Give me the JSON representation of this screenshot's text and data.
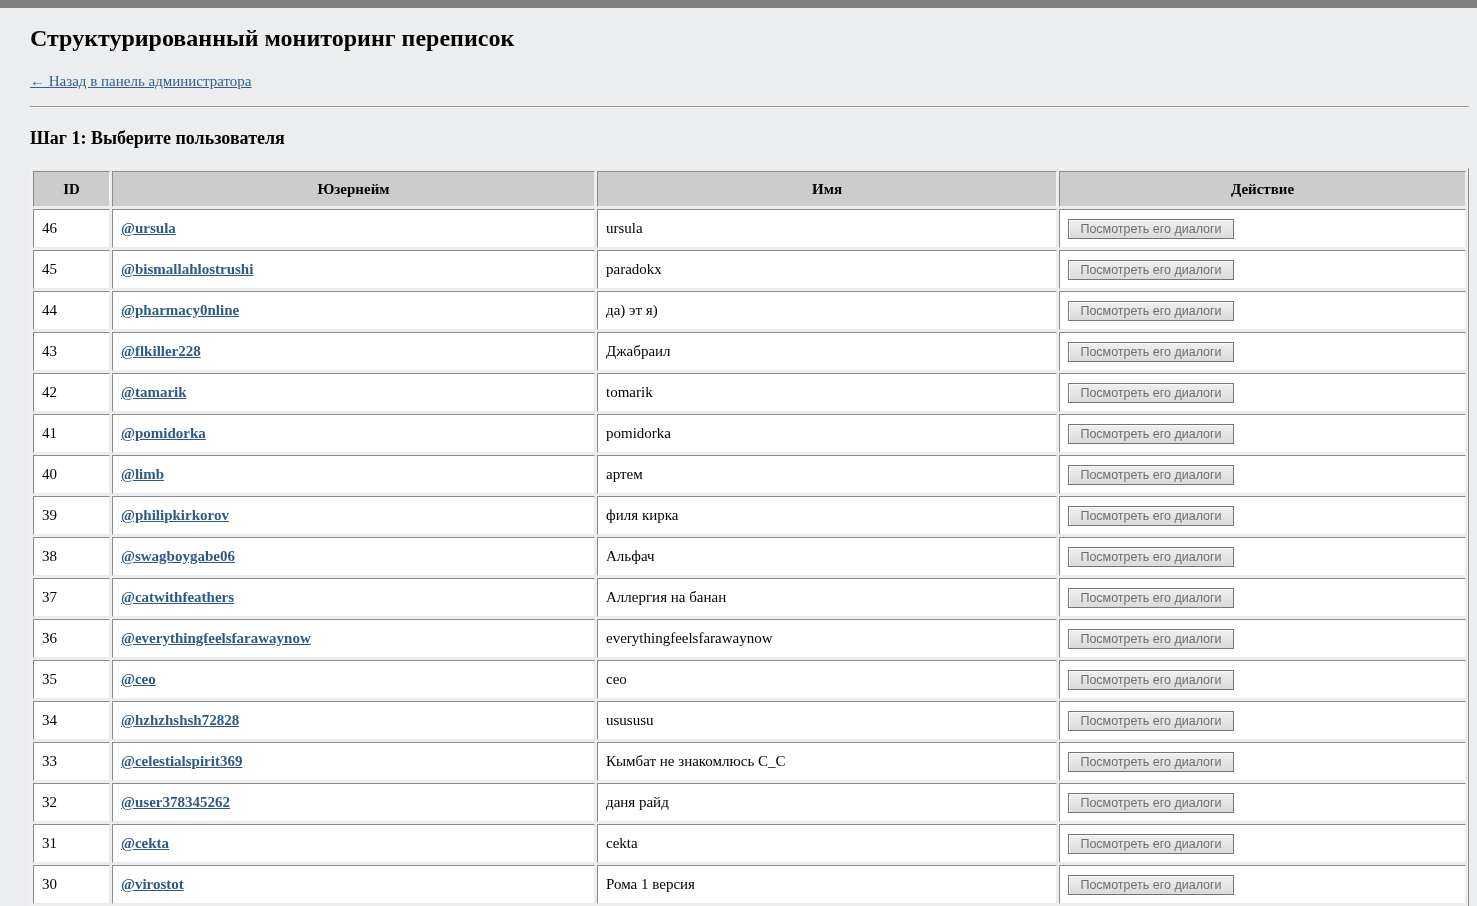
{
  "page": {
    "title": "Структурированный мониторинг переписок",
    "back_link": "← Назад в панель администратора"
  },
  "step_title": "Шаг 1: Выберите пользователя",
  "table": {
    "columns": [
      "ID",
      "Юзернейм",
      "Имя",
      "Действие"
    ],
    "rows": [
      {
        "id": "46",
        "username": "@ursula",
        "name": "ursula",
        "action": {
          "label": "Посмотреть его диалоги",
          "disabled": true
        }
      },
      {
        "id": "45",
        "username": "@bismallahlostrushi",
        "name": "paradokx",
        "action": {
          "label": "Посмотреть его диалоги",
          "disabled": true
        }
      },
      {
        "id": "44",
        "username": "@pharmacy0nline",
        "name": "да) эт я)",
        "action": {
          "label": "Посмотреть его диалоги",
          "disabled": true
        }
      },
      {
        "id": "43",
        "username": "@flkiller228",
        "name": "Джабраил",
        "action": {
          "label": "Посмотреть его диалоги",
          "disabled": true
        }
      },
      {
        "id": "42",
        "username": "@tamarik",
        "name": "tomarik",
        "action": {
          "label": "Посмотреть его диалоги",
          "disabled": true
        }
      },
      {
        "id": "41",
        "username": "@pomidorka",
        "name": "pomidorka",
        "action": {
          "label": "Посмотреть его диалоги",
          "disabled": true
        }
      },
      {
        "id": "40",
        "username": "@limb",
        "name": "артем",
        "action": {
          "label": "Посмотреть его диалоги",
          "disabled": true
        }
      },
      {
        "id": "39",
        "username": "@philipkirkorov",
        "name": "филя кирка",
        "action": {
          "label": "Посмотреть его диалоги",
          "disabled": true
        }
      },
      {
        "id": "38",
        "username": "@swagboygabe06",
        "name": "Альфач",
        "action": {
          "label": "Посмотреть его диалоги",
          "disabled": true
        }
      },
      {
        "id": "37",
        "username": "@catwithfeathers",
        "name": "Аллергия на банан",
        "action": {
          "label": "Посмотреть его диалоги",
          "disabled": true
        }
      },
      {
        "id": "36",
        "username": "@everythingfeelsfarawaynow",
        "name": "everythingfeelsfarawaynow",
        "action": {
          "label": "Посмотреть его диалоги",
          "disabled": true
        }
      },
      {
        "id": "35",
        "username": "@ceo",
        "name": "ceo",
        "action": {
          "label": "Посмотреть его диалоги",
          "disabled": true
        }
      },
      {
        "id": "34",
        "username": "@hzhzhshsh72828",
        "name": "usususu",
        "action": {
          "label": "Посмотреть его диалоги",
          "disabled": true
        }
      },
      {
        "id": "33",
        "username": "@celestialspirit369",
        "name": "Кымбат не знакомлюсь С_С",
        "action": {
          "label": "Посмотреть его диалоги",
          "disabled": true
        }
      },
      {
        "id": "32",
        "username": "@user378345262",
        "name": "даня райд",
        "action": {
          "label": "Посмотреть его диалоги",
          "disabled": true
        }
      },
      {
        "id": "31",
        "username": "@cekta",
        "name": "cekta",
        "action": {
          "label": "Посмотреть его диалоги",
          "disabled": true
        }
      },
      {
        "id": "30",
        "username": "@virostot",
        "name": "Рома 1 версия",
        "action": {
          "label": "Посмотреть его диалоги",
          "disabled": true
        }
      }
    ]
  }
}
